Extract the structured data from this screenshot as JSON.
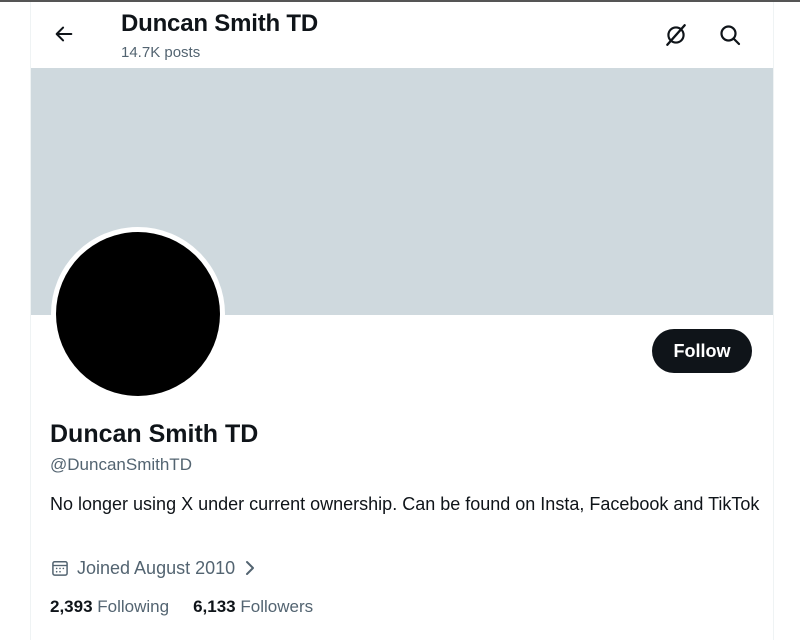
{
  "header": {
    "title": "Duncan Smith TD",
    "post_count": "14.7K posts"
  },
  "profile": {
    "display_name": "Duncan Smith TD",
    "handle": "@DuncanSmithTD",
    "bio": "No longer using X under current ownership. Can be found on Insta, Facebook and TikTok",
    "joined": "Joined August 2010",
    "follow_label": "Follow",
    "following_count": "2,393",
    "following_label": "Following",
    "followers_count": "6,133",
    "followers_label": "Followers"
  },
  "icons": {
    "back": "arrow-left-icon",
    "grok": "grok-icon",
    "search": "search-icon",
    "calendar": "calendar-icon",
    "chevron": "chevron-right-icon"
  },
  "colors": {
    "banner": "#cfd9de",
    "text_primary": "#0f1419",
    "text_secondary": "#536471",
    "button": "#0f1419"
  }
}
